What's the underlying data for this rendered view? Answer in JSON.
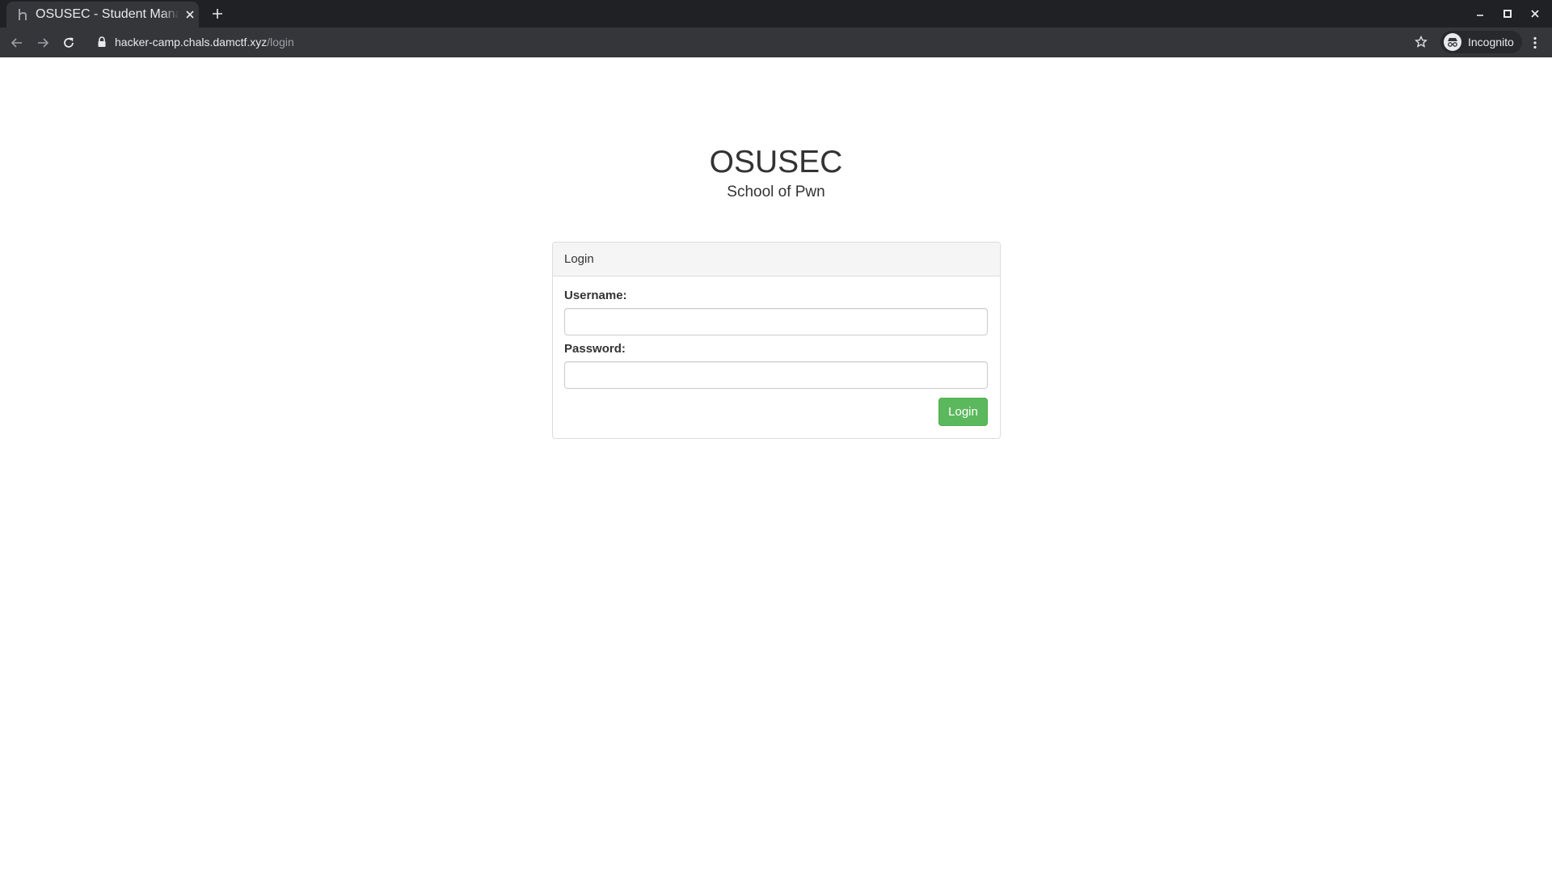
{
  "browser": {
    "tab": {
      "title": "OSUSEC - Student Management",
      "favicon": "h-favicon-icon"
    },
    "address_bar": {
      "host": "hacker-camp.chals.damctf.xyz",
      "path": "/login"
    },
    "profile": {
      "label": "Incognito"
    }
  },
  "page": {
    "title": "OSUSEC",
    "subtitle": "School of Pwn",
    "login_panel": {
      "heading": "Login",
      "username_label": "Username:",
      "username_value": "",
      "password_label": "Password:",
      "password_value": "",
      "submit_label": "Login"
    }
  },
  "colors": {
    "chrome_dark": "#202124",
    "chrome_toolbar": "#35363a",
    "text": "#333333",
    "panel_heading_bg": "#f5f5f5",
    "panel_border": "#dddddd",
    "success_button": "#5cb85c"
  }
}
